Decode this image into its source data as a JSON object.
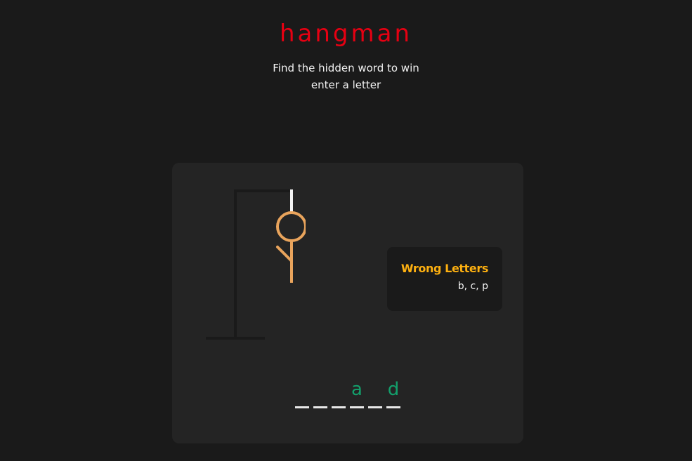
{
  "header": {
    "title": "hangman",
    "subtitle_line1": "Find the hidden word to win",
    "subtitle_line2": "enter a letter"
  },
  "wrong_letters": {
    "heading": "Wrong Letters",
    "letters": "b, c, p"
  },
  "word": {
    "slots": [
      "",
      "",
      "",
      "a",
      "",
      "d"
    ]
  },
  "game_state": {
    "wrong_guess_count": 3,
    "drawn_parts": [
      "head",
      "body",
      "arm"
    ]
  },
  "colors": {
    "background": "#1a1a1a",
    "panel": "#242424",
    "title": "#e60012",
    "accent": "#fdb010",
    "figure": "#e9a45c",
    "gallows": "#1a1a1a",
    "rope": "#f2f2f2",
    "correct_letter": "#13a06c"
  }
}
